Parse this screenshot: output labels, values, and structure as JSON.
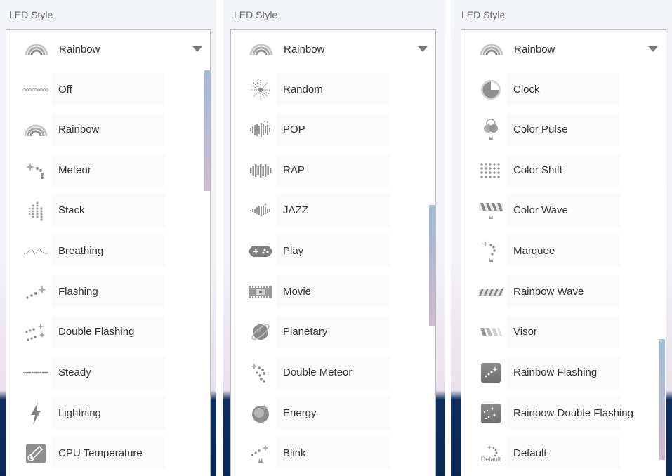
{
  "panels": [
    {
      "label": "LED Style",
      "selected": "Rainbow",
      "selected_icon": "rainbow-icon",
      "items": [
        {
          "label": "Off",
          "icon": "dotted-line-icon"
        },
        {
          "label": "Rainbow",
          "icon": "rainbow-icon"
        },
        {
          "label": "Meteor",
          "icon": "meteor-icon"
        },
        {
          "label": "Stack",
          "icon": "stack-icon"
        },
        {
          "label": "Breathing",
          "icon": "breathing-wave-icon"
        },
        {
          "label": "Flashing",
          "icon": "flashing-icon"
        },
        {
          "label": "Double Flashing",
          "icon": "double-flashing-icon"
        },
        {
          "label": "Steady",
          "icon": "steady-dots-icon"
        },
        {
          "label": "Lightning",
          "icon": "lightning-bolt-icon"
        },
        {
          "label": "CPU Temperature",
          "icon": "thermometer-icon"
        }
      ]
    },
    {
      "label": "LED Style",
      "selected": "Rainbow",
      "selected_icon": "rainbow-icon",
      "items": [
        {
          "label": "Random",
          "icon": "random-burst-icon"
        },
        {
          "label": "POP",
          "icon": "pop-equalizer-icon"
        },
        {
          "label": "RAP",
          "icon": "rap-equalizer-icon"
        },
        {
          "label": "JAZZ",
          "icon": "jazz-equalizer-icon"
        },
        {
          "label": "Play",
          "icon": "gamepad-icon"
        },
        {
          "label": "Movie",
          "icon": "film-icon"
        },
        {
          "label": "Planetary",
          "icon": "planet-icon"
        },
        {
          "label": "Double Meteor",
          "icon": "double-meteor-icon"
        },
        {
          "label": "Energy",
          "icon": "energy-orb-icon"
        },
        {
          "label": "Blink",
          "icon": "blink-icon"
        }
      ]
    },
    {
      "label": "LED Style",
      "selected": "Rainbow",
      "selected_icon": "rainbow-icon",
      "items": [
        {
          "label": "Clock",
          "icon": "clock-icon"
        },
        {
          "label": "Color Pulse",
          "icon": "color-pulse-icon"
        },
        {
          "label": "Color Shift",
          "icon": "color-shift-grid-icon"
        },
        {
          "label": "Color Wave",
          "icon": "color-wave-stripes-icon"
        },
        {
          "label": "Marquee",
          "icon": "marquee-icon"
        },
        {
          "label": "Rainbow Wave",
          "icon": "rainbow-wave-stripes-icon"
        },
        {
          "label": "Visor",
          "icon": "visor-icon"
        },
        {
          "label": "Rainbow Flashing",
          "icon": "rainbow-flashing-icon"
        },
        {
          "label": "Rainbow Double Flashing",
          "icon": "rainbow-double-flashing-icon"
        },
        {
          "label": "Default",
          "icon": "default-icon",
          "icon_caption": "Default"
        }
      ]
    }
  ]
}
